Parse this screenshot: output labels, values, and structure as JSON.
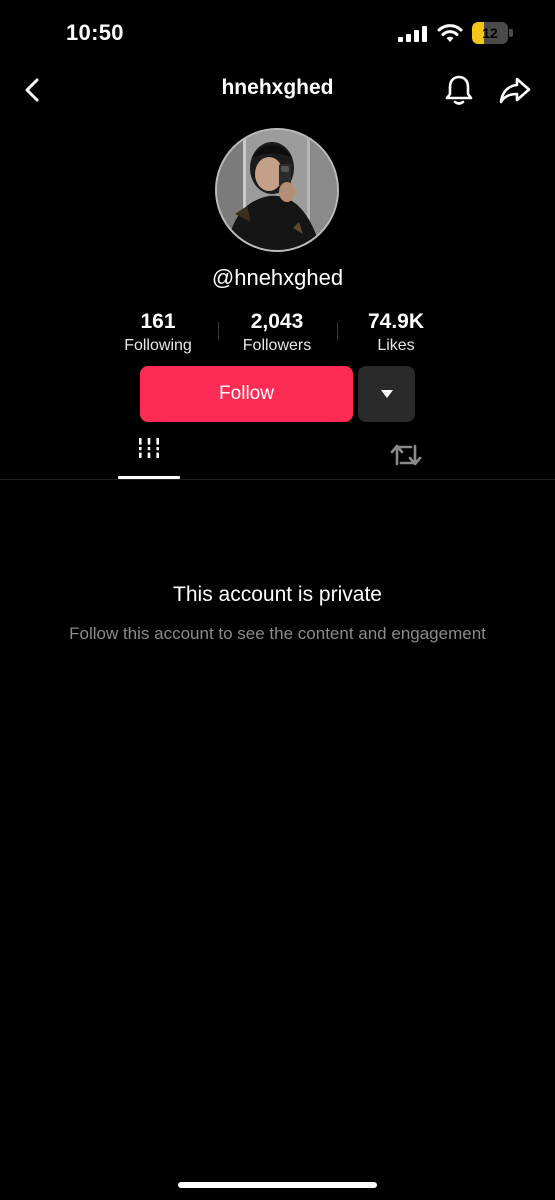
{
  "status_bar": {
    "time": "10:50",
    "battery_level": "12",
    "battery_color": "#f5c518"
  },
  "header": {
    "title": "hnehxghed",
    "icons": [
      "back-icon",
      "bell-icon",
      "share-icon"
    ]
  },
  "profile": {
    "handle": "@hnehxghed",
    "stats": [
      {
        "value": "161",
        "label": "Following"
      },
      {
        "value": "2,043",
        "label": "Followers"
      },
      {
        "value": "74.9K",
        "label": "Likes"
      }
    ],
    "follow_label": "Follow",
    "follow_color": "#fe2c55"
  },
  "tabs": {
    "items": [
      {
        "icon": "videos-grid-icon",
        "active": true
      },
      {
        "icon": "repost-icon",
        "active": false
      }
    ]
  },
  "private": {
    "title": "This account is private",
    "subtitle": "Follow this account to see the content and engagement"
  }
}
